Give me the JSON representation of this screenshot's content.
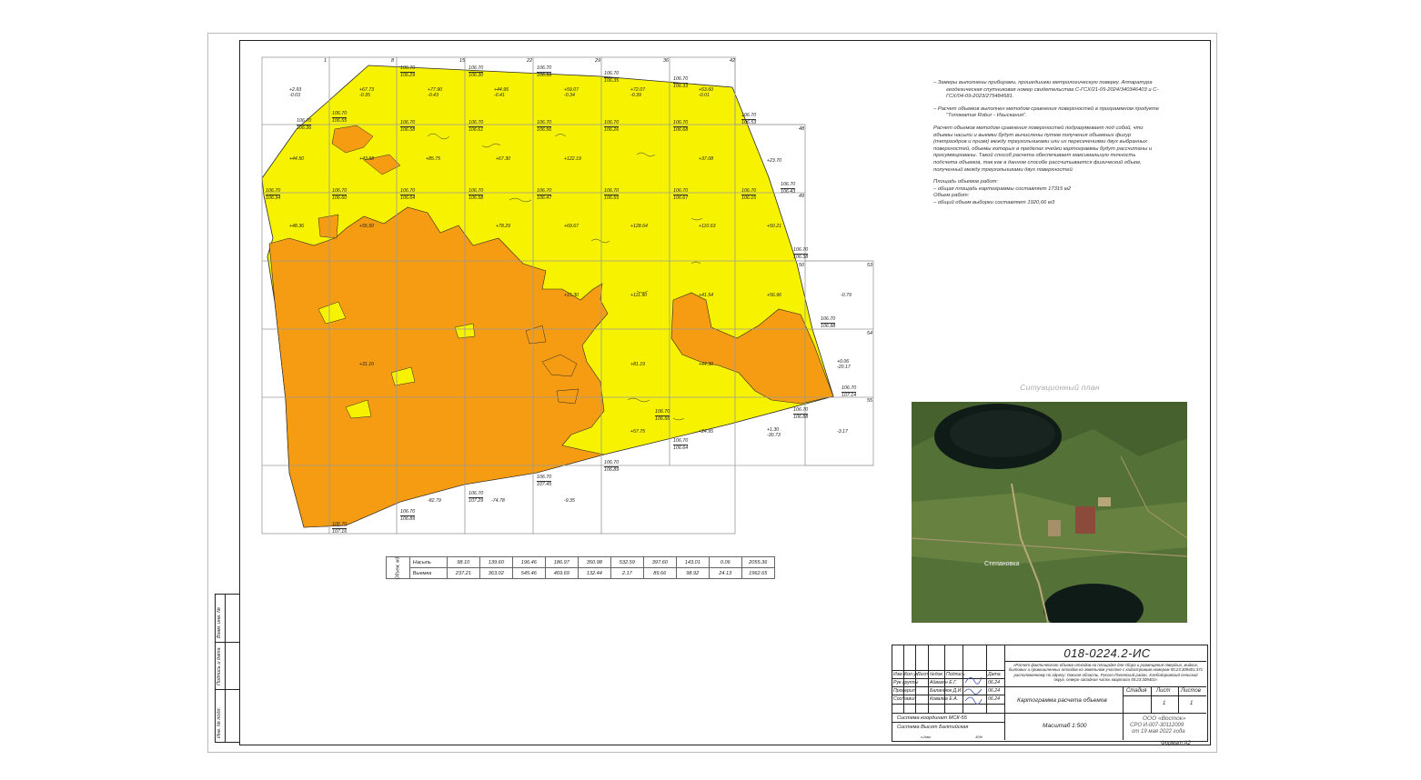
{
  "notes": {
    "p1": "–     Замеры выполнены приборами, прошедшими метрологическую поверку. Аппаратура геодезическая спутниковая номер свидетельства С-ГСХ/21-05-2024/340346403 и С-ГСХ/04-09-2023/275484581.",
    "p2": "–     Расчет объемов выполнен методом сравнения поверхностей в программном продукте \"Топоматик Robur - Изыскания\".",
    "p3": "Расчет объемов методом сравнения поверхностей подразумевает под собой, что объемы насыпи и выемки будут вычислены путем получения объемных фигур (тетраэдров и призм) между треугольниками или их пересечениями двух выбранных поверхностей, объемы которых в пределах ячейки картограммы будут рассчитаны и просуммированы. Такой способ расчета обеспечивает максимальную точность подсчета объемов, так как в данном способе рассчитывается физический объем, полученный между треугольниками двух поверхностей.",
    "area_title": "Площадь объемов работ:",
    "area_item": "–     общая площадь картограммы составляет 17315 м2",
    "vol_title": "Объем работ:",
    "vol_item": "–     общий объем выборки составляет 1920,66 м3"
  },
  "situation": {
    "title": "Ситуационный план",
    "village": "Степановка"
  },
  "grid": {
    "top_labels": [
      "1",
      "8",
      "15",
      "22",
      "29",
      "36",
      "42"
    ],
    "right_labels": [
      "48",
      "49",
      "50",
      "53",
      "54",
      "55"
    ],
    "cell_values": [
      {
        "t": "106.70",
        "b": "106.29"
      },
      {
        "t": "106.70",
        "b": "106.30"
      },
      {
        "t": "106.70",
        "b": "106.59"
      },
      {
        "t": "106.70",
        "b": "106.35"
      },
      {
        "t": "106.70",
        "b": "106.33"
      },
      {
        "t": "106.70",
        "b": "106.36"
      },
      {
        "t": "106.70",
        "b": "106.55"
      },
      {
        "t": "106.70",
        "b": "106.58"
      },
      {
        "t": "106.70",
        "b": "106.61"
      },
      {
        "t": "106.70",
        "b": "106.56"
      },
      {
        "t": "106.70",
        "b": "106.26"
      },
      {
        "t": "106.70",
        "b": "106.68"
      },
      {
        "t": "106.70",
        "b": "106.53"
      },
      {
        "t": "106.70",
        "b": "106.34"
      },
      {
        "t": "106.70",
        "b": "106.60"
      },
      {
        "t": "106.70",
        "b": "106.64"
      },
      {
        "t": "106.70",
        "b": "106.58"
      },
      {
        "t": "106.70",
        "b": "106.47"
      },
      {
        "t": "106.70",
        "b": "106.55"
      },
      {
        "t": "106.70",
        "b": "106.67"
      },
      {
        "t": "106.70",
        "b": "106.16"
      },
      {
        "t": "106.70",
        "b": "106.43"
      },
      {
        "t": "106.70",
        "b": "106.38"
      },
      {
        "t": "106.70",
        "b": "106.98"
      },
      {
        "t": "106.70",
        "b": "107.14"
      },
      {
        "t": "106.70",
        "b": "106.88"
      },
      {
        "t": "106.70",
        "b": "106.56"
      },
      {
        "t": "106.70",
        "b": "106.64"
      },
      {
        "t": "106.70",
        "b": "106.89"
      },
      {
        "t": "106.70",
        "b": "107.45"
      },
      {
        "t": "106.70",
        "b": "107.29"
      },
      {
        "t": "106.70",
        "b": "106.89"
      },
      {
        "t": "106.70",
        "b": "107.16"
      }
    ],
    "diffs": [
      "+2.93",
      "-0.03",
      "+67.73",
      "-0.35",
      "+77.90",
      "-0.43",
      "+44.95",
      "-0.41",
      "+59.07",
      "-0.34",
      "+72.07",
      "-0.39",
      "+53.60",
      "-0.01",
      "+44.50",
      "+43.98",
      "+85.75",
      "+67.30",
      "+122.19",
      "+37.08",
      "+23.70",
      "+48.36",
      "+55.50",
      "+78.29",
      "+69.67",
      "+128.64",
      "+110.63",
      "+50.21",
      "+15.30",
      "+111.90",
      "+41.54",
      "+56.96",
      "-0.79",
      "+31.10",
      "+81.19",
      "+44.30",
      "+0.06",
      "-20.17",
      "+57.75",
      "+24.95",
      "+1.30",
      "-30.73",
      "-3.17",
      "-82.79",
      "-74.78",
      "-9.35"
    ]
  },
  "volumes": {
    "row_label": "Объем, м3",
    "fill_label": "Насыпь",
    "cut_label": "Выемка",
    "fill": [
      "98.10",
      "139.60",
      "196.46",
      "186.97",
      "350.98",
      "532.59",
      "397.60",
      "143.01",
      "0.06",
      "2055.36"
    ],
    "cut": [
      "237.21",
      "363.02",
      "545.46",
      "469.69",
      "132.44",
      "2.17",
      "89.66",
      "98.92",
      "24.13",
      "1962.65"
    ]
  },
  "side_stamp": [
    "Инв. № подл.",
    "Подпись и дата",
    "Взам. инв. №"
  ],
  "stamp": {
    "code": "018-0224.2-ИС",
    "description": "«Расчет фактического объема отходов на площадке для сбора и размещения твердых, жидких, бытовых и промышленных отходов на земельном участке с кадастровым номером 55:23:309401:371 расположенному по адресу: Омская область, Русско-Полянский район, Хлебодаровский сельский округ, северо-западная часть квартала 55:23:309401»",
    "headers": [
      "Изм.",
      "Кол.уч.",
      "Лист",
      "№док.",
      "Подпись",
      "Дата"
    ],
    "people": [
      {
        "role": "Рук.группы",
        "name": "Айвазян Е.Г.",
        "date": "06.24"
      },
      {
        "role": "Проверил",
        "name": "Баландюк Д.И.",
        "date": "06.24"
      },
      {
        "role": "Составил",
        "name": "Ковалев Е.А.",
        "date": "06.24"
      }
    ],
    "sheet_title": "Картограмма расчета объемов",
    "stage_h": "Стадия",
    "sheet_h": "Лист",
    "sheets_h": "Листов",
    "sheet_no": "1",
    "sheets_no": "1",
    "coord_system": "Система координат МСК-55",
    "height_system": "Система Высот Балтийская",
    "scale": "Масштаб 1:500",
    "org_name": "ООО «Восток»",
    "org_sro": "СРО И-007-30112009",
    "org_date": "от 19 мая 2022 года",
    "copy_l": "з.2мм",
    "copy_r": "30%",
    "format": "Формат А2"
  },
  "colors": {
    "fill_yellow": "#f6f200",
    "cut_orange": "#f59c12",
    "grid": "#9a9a9a"
  }
}
